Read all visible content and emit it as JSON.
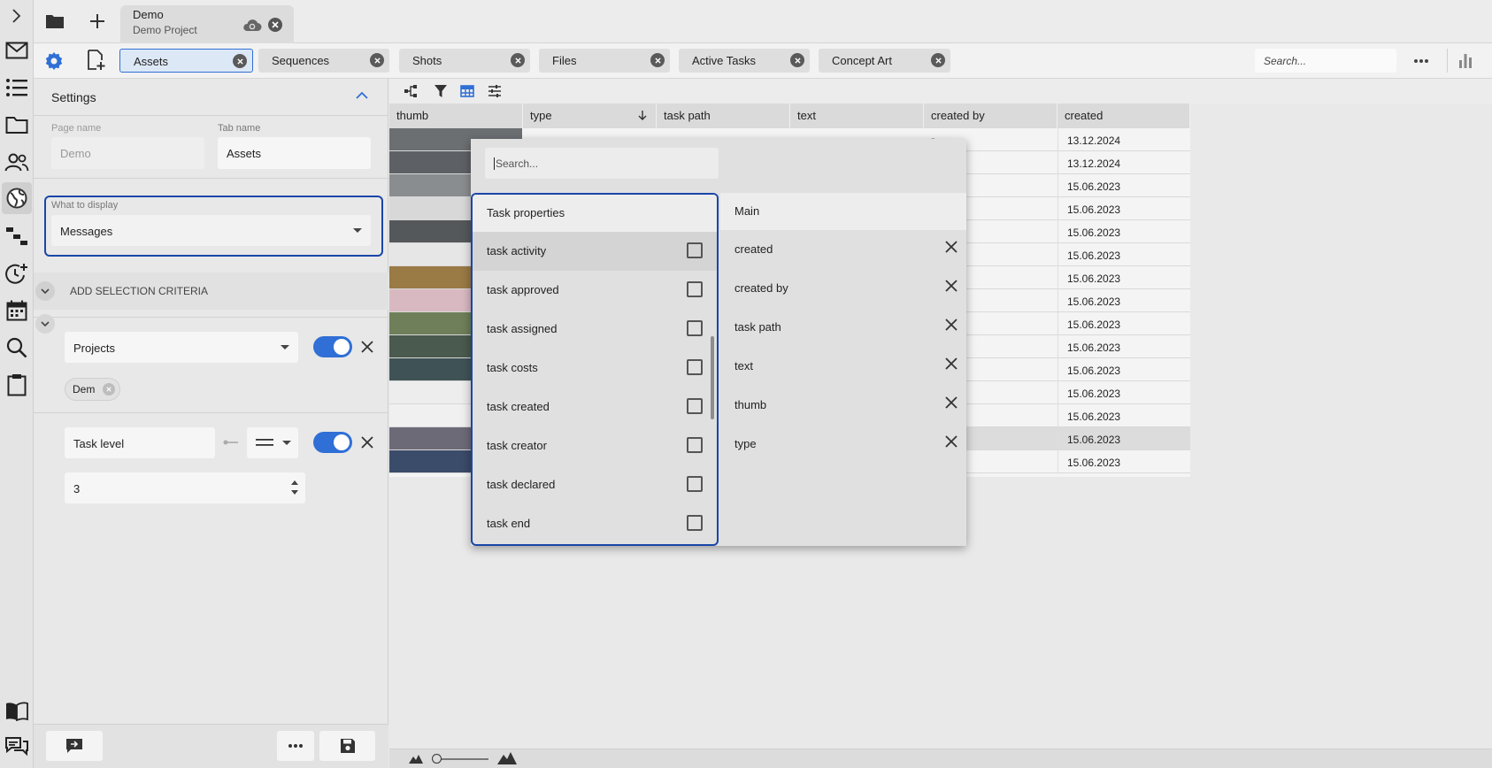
{
  "project": {
    "name": "Demo",
    "subtitle": "Demo Project"
  },
  "tabs": [
    {
      "label": "Assets",
      "active": true
    },
    {
      "label": "Sequences"
    },
    {
      "label": "Shots"
    },
    {
      "label": "Files"
    },
    {
      "label": "Active Tasks"
    },
    {
      "label": "Concept Art"
    }
  ],
  "top_search": {
    "placeholder": "Search..."
  },
  "settings": {
    "title": "Settings",
    "page_name_label": "Page name",
    "page_name_value": "Demo",
    "tab_name_label": "Tab name",
    "tab_name_value": "Assets",
    "display_label": "What to display",
    "display_value": "Messages",
    "add_criteria": "ADD SELECTION CRITERIA",
    "criteria1": {
      "field": "Projects",
      "chip": "Dem",
      "enabled": true
    },
    "criteria2": {
      "field": "Task level",
      "operator": "==",
      "value": "3",
      "enabled": true
    }
  },
  "grid": {
    "columns": [
      "thumb",
      "type",
      "task path",
      "text",
      "created by",
      "created"
    ],
    "rows": [
      {
        "created_by": "r",
        "created": "13.12.2024"
      },
      {
        "created_by": "r",
        "created": "13.12.2024"
      },
      {
        "created_by": "",
        "created": "15.06.2023"
      },
      {
        "created_by": "",
        "created": "15.06.2023"
      },
      {
        "created_by": "",
        "created": "15.06.2023"
      },
      {
        "created_by": "",
        "created": "15.06.2023"
      },
      {
        "created_by": "",
        "created": "15.06.2023"
      },
      {
        "created_by": "",
        "created": "15.06.2023"
      },
      {
        "created_by": "",
        "created": "15.06.2023"
      },
      {
        "created_by": "",
        "created": "15.06.2023"
      },
      {
        "created_by": "",
        "created": "15.06.2023"
      },
      {
        "created_by": "",
        "created": "15.06.2023"
      },
      {
        "created_by": "",
        "created": "15.06.2023"
      },
      {
        "created_by": "",
        "created": "15.06.2023"
      },
      {
        "created_by": "",
        "created": "15.06.2023"
      }
    ]
  },
  "column_picker": {
    "search_placeholder": "Search...",
    "left_title": "Task properties",
    "properties": [
      "task activity",
      "task approved",
      "task assigned",
      "task costs",
      "task created",
      "task creator",
      "task declared",
      "task end"
    ],
    "right_title": "Main",
    "selected": [
      "created",
      "created by",
      "task path",
      "text",
      "thumb",
      "type"
    ]
  },
  "colors": {
    "accent": "#2f6fd6",
    "focus_border": "#1a46a8"
  }
}
